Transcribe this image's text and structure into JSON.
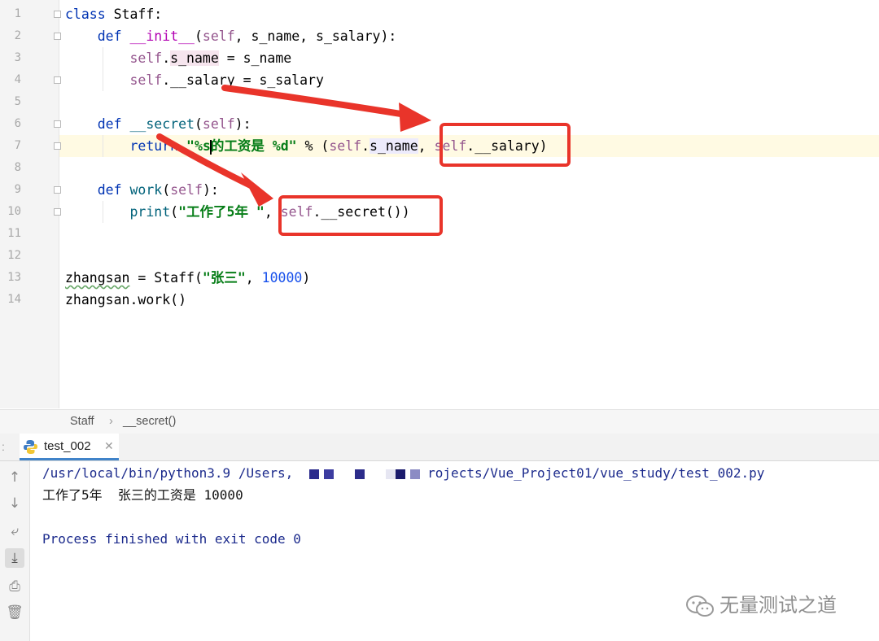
{
  "editor": {
    "line_numbers": [
      "1",
      "2",
      "3",
      "4",
      "5",
      "6",
      "7",
      "8",
      "9",
      "10",
      "11",
      "12",
      "13",
      "14"
    ],
    "code": {
      "l1_kw": "class",
      "l1_rest": " Staff:",
      "l2_kw": "def",
      "l2_fn": "__init__",
      "l2_open": "(",
      "l2_self": "self",
      "l2_rest": ", s_name, s_salary):",
      "l3_self": "self",
      "l3_dot": ".",
      "l3_attr": "s_name",
      "l3_rest": " = s_name",
      "l4_self": "self",
      "l4_rest": ".__salary = s_salary",
      "l6_kw": "def",
      "l6_fn": "__secret",
      "l6_open": "(",
      "l6_self": "self",
      "l6_rest": "):",
      "l7_kw": "return",
      "l7_str_a": " \"%s",
      "l7_str_b": "的工资是 %d\"",
      "l7_mid": " % (",
      "l7_self1": "self",
      "l7_dot1": ".",
      "l7_attr1": "s_name",
      "l7_comma": ", ",
      "l7_self2": "self",
      "l7_rest": ".__salary)",
      "l9_kw": "def",
      "l9_fn": "work",
      "l9_open": "(",
      "l9_self": "self",
      "l9_rest": "):",
      "l10_fn": "print",
      "l10_open": "(",
      "l10_str": "\"工作了5年 \"",
      "l10_comma": ", ",
      "l10_self": "self",
      "l10_rest": ".__secret())",
      "l13_var": "zhangsan",
      "l13_mid": " = Staff(",
      "l13_str": "\"张三\"",
      "l13_comma": ", ",
      "l13_num": "10000",
      "l13_close": ")",
      "l14_text": "zhangsan.work()"
    }
  },
  "breadcrumb": {
    "item1": "Staff",
    "separator": "›",
    "item2": "__secret()"
  },
  "run_tab": {
    "label": "test_002",
    "close": "✕",
    "icon": "python-icon"
  },
  "console": {
    "path_a": "/usr/local/bin/python3.9 /Users,",
    "path_b": "rojects/Vue_Project01/vue_study/test_002.py",
    "output": "工作了5年  张三的工资是 10000",
    "process": "Process finished with exit code 0"
  },
  "side_icons": [
    "arrow-up-icon",
    "arrow-down-icon",
    "soft-wrap-icon",
    "scroll-to-end-icon",
    "print-icon",
    "trash-icon"
  ],
  "watermark": {
    "text": "无量测试之道"
  },
  "colors": {
    "annotation_red": "#e9342a",
    "keyword": "#0033b3",
    "self": "#94558d",
    "string": "#067d17",
    "number": "#1750eb"
  }
}
